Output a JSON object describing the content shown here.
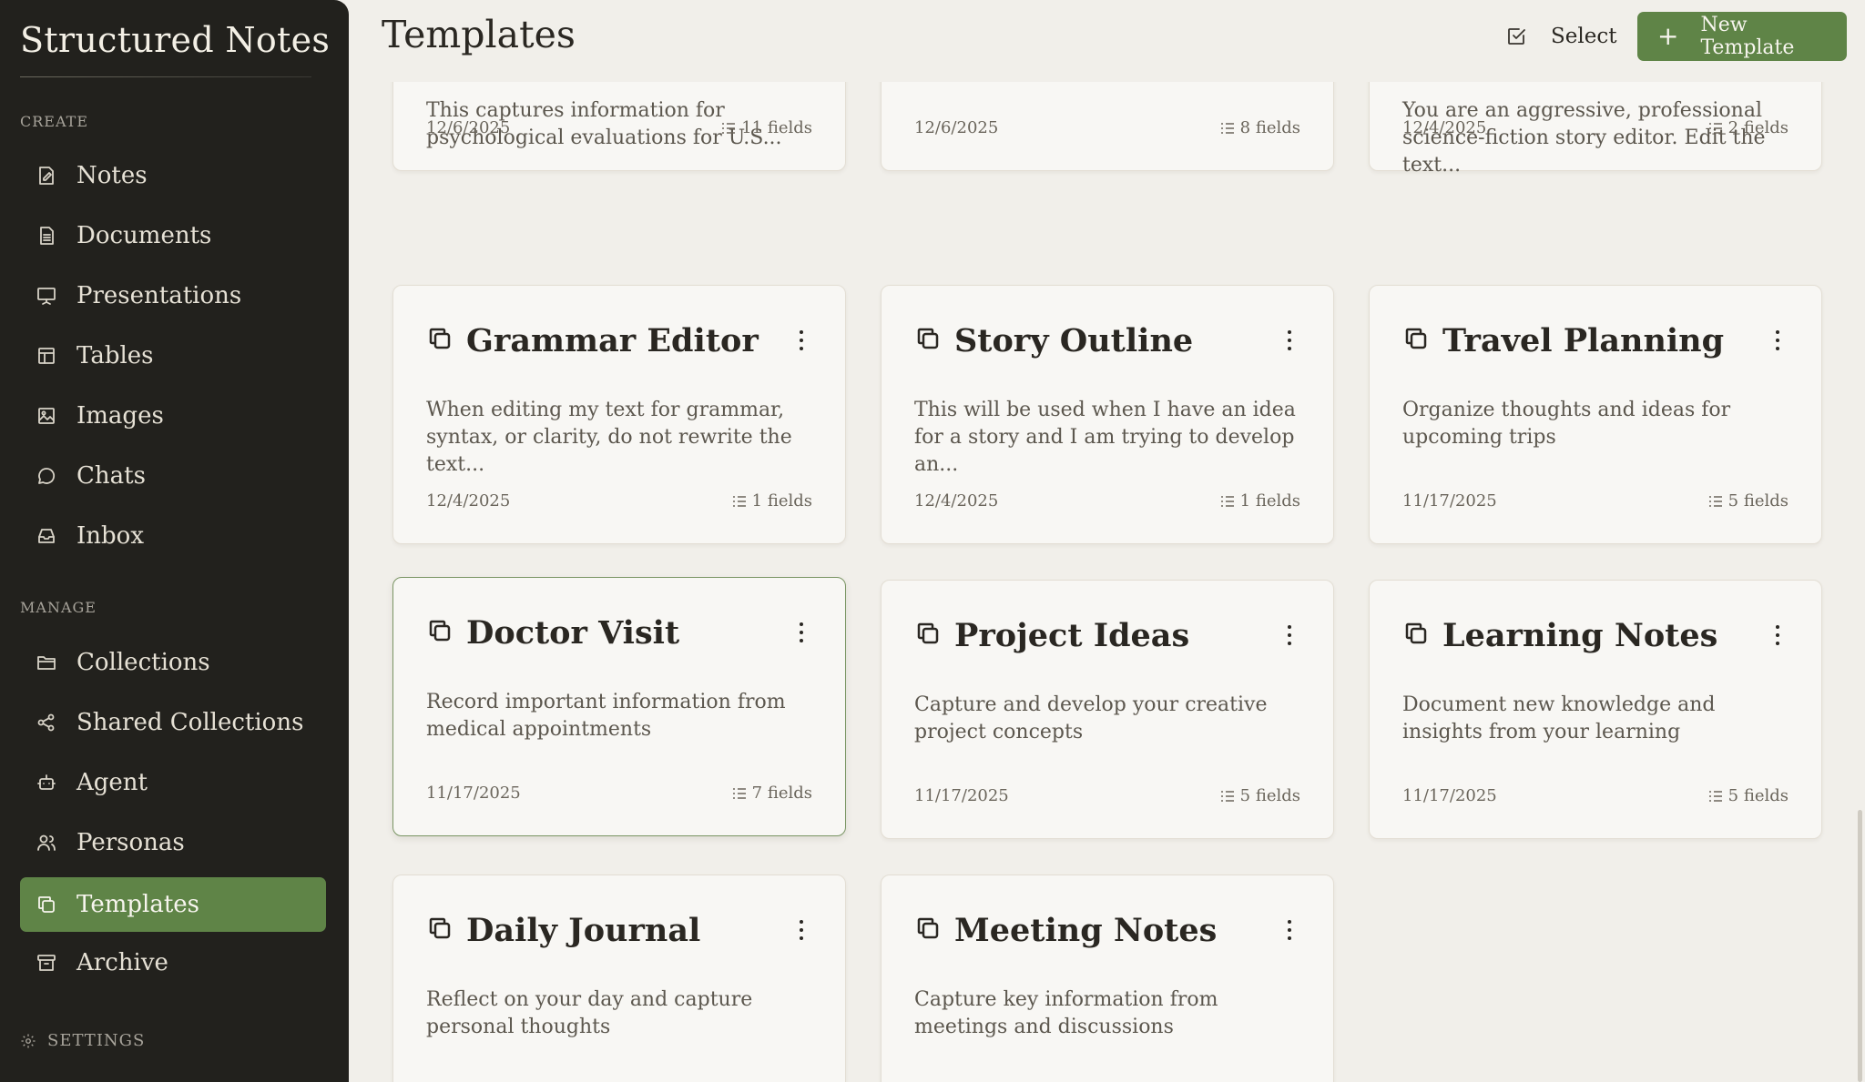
{
  "app": {
    "title": "Structured Notes"
  },
  "sidebar": {
    "create_label": "CREATE",
    "manage_label": "MANAGE",
    "create_items": [
      {
        "label": "Notes",
        "icon": "note-icon"
      },
      {
        "label": "Documents",
        "icon": "document-icon"
      },
      {
        "label": "Presentations",
        "icon": "presentation-icon"
      },
      {
        "label": "Tables",
        "icon": "table-icon"
      },
      {
        "label": "Images",
        "icon": "image-icon"
      },
      {
        "label": "Chats",
        "icon": "chat-icon"
      },
      {
        "label": "Inbox",
        "icon": "inbox-icon"
      }
    ],
    "manage_items": [
      {
        "label": "Collections",
        "icon": "folder-icon"
      },
      {
        "label": "Shared Collections",
        "icon": "share-icon"
      },
      {
        "label": "Agent",
        "icon": "robot-icon"
      },
      {
        "label": "Personas",
        "icon": "users-icon"
      },
      {
        "label": "Templates",
        "icon": "copy-icon",
        "active": true
      },
      {
        "label": "Archive",
        "icon": "archive-icon"
      }
    ],
    "settings_label": "SETTINGS"
  },
  "header": {
    "title": "Templates",
    "select_label": "Select",
    "new_template_label": "New Template"
  },
  "theme": {
    "accent": "#5f8447",
    "sidebar_bg": "#22211d",
    "page_bg": "#f1efea",
    "card_bg": "#f8f7f4"
  },
  "cards": [
    {
      "title": "",
      "description": "This captures information for psychological evaluations for U.S...",
      "date": "12/6/2025",
      "fields": "11 fields"
    },
    {
      "title": "",
      "description": "",
      "date": "12/6/2025",
      "fields": "8 fields"
    },
    {
      "title": "",
      "description": "You are an aggressive, professional science-fiction story editor. Edit the text...",
      "date": "12/4/2025",
      "fields": "2 fields"
    },
    {
      "title": "Grammar Editor",
      "description": "When editing my text for grammar, syntax, or clarity, do not rewrite the text...",
      "date": "12/4/2025",
      "fields": "1 fields"
    },
    {
      "title": "Story Outline",
      "description": "This will be used when I have an idea for a story and I am trying to develop an...",
      "date": "12/4/2025",
      "fields": "1 fields"
    },
    {
      "title": "Travel Planning",
      "description": "Organize thoughts and ideas for upcoming trips",
      "date": "11/17/2025",
      "fields": "5 fields"
    },
    {
      "title": "Doctor Visit",
      "description": "Record important information from medical appointments",
      "date": "11/17/2025",
      "fields": "7 fields"
    },
    {
      "title": "Project Ideas",
      "description": "Capture and develop your creative project concepts",
      "date": "11/17/2025",
      "fields": "5 fields"
    },
    {
      "title": "Learning Notes",
      "description": "Document new knowledge and insights from your learning",
      "date": "11/17/2025",
      "fields": "5 fields"
    },
    {
      "title": "Daily Journal",
      "description": "Reflect on your day and capture personal thoughts",
      "date": "",
      "fields": ""
    },
    {
      "title": "Meeting Notes",
      "description": "Capture key information from meetings and discussions",
      "date": "",
      "fields": ""
    }
  ]
}
